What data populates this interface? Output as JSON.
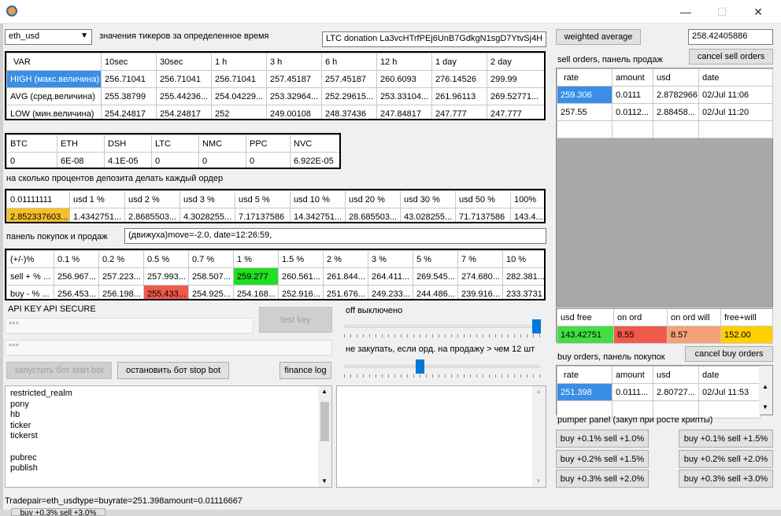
{
  "window": {
    "minimize": "—",
    "maximize": "☐",
    "close": "✕"
  },
  "pair_select": "eth_usd",
  "ticker_caption": "значения тикеров за определенное время",
  "ltc_donation": "LTC donation  La3vcHTrfPEj6UnB7GdkgN1sgD7YtvSj4H",
  "weighted_average_btn": "weighted average",
  "weighted_value": "258.42405886",
  "sell_orders_caption": "sell orders, панель продаж",
  "cancel_sell_btn": "cancel sell orders",
  "ticker_table": {
    "headers": [
      "VAR",
      "10sec",
      "30sec",
      "1 h",
      "3 h",
      "6 h",
      "12 h",
      "1 day",
      "2 day"
    ],
    "rows": [
      [
        "HIGH (макс.величина)",
        "256.71041",
        "256.71041",
        "256.71041",
        "257.45187",
        "257.45187",
        "260.6093",
        "276.14526",
        "299.99"
      ],
      [
        "AVG (сред.величина)",
        "255.38799",
        "255.44236...",
        "254.04229...",
        "253.32964...",
        "252.29615...",
        "253.33104...",
        "261.96113",
        "269.52771..."
      ],
      [
        "LOW (мин.величина)",
        "254.24817",
        "254.24817",
        "252",
        "249.00108",
        "248.37436",
        "247.84817",
        "247.777",
        "247.777"
      ]
    ]
  },
  "balance_table": {
    "headers": [
      "BTC",
      "ETH",
      "DSH",
      "LTC",
      "NMC",
      "PPC",
      "NVC"
    ],
    "values": [
      "0",
      "6E-08",
      "4.1E-05",
      "0",
      "0",
      "0",
      "6.922E-05"
    ]
  },
  "deposit_caption": "на сколько процентов депозита делать каждый ордер",
  "deposit_table": {
    "headers": [
      "0.01111111",
      "usd 1 %",
      "usd 2 %",
      "usd 3 %",
      "usd 5 %",
      "usd 10 %",
      "usd 20 %",
      "usd 30 %",
      "usd 50 %",
      "100%"
    ],
    "values": [
      "2.852337603...",
      "1.4342751...",
      "2.8685503...",
      "4.3028255...",
      "7.17137586",
      "14.342751...",
      "28.685503...",
      "43.028255...",
      "71.7137586",
      "143.4..."
    ]
  },
  "trade_panel_caption": "панель покупок и продаж",
  "move_text": "(движуха)move=-2.0, date=12:26:59,",
  "percent_table": {
    "headers": [
      "(+/-)%",
      "0.1 %",
      "0.2 %",
      "0.5 %",
      "0.7 %",
      "1 %",
      "1.5 %",
      "2 %",
      "3 %",
      "5 %",
      "7 %",
      "10 %"
    ],
    "sell": [
      "sell + % ...",
      "256.967...",
      "257.223...",
      "257.993...",
      "258.507...",
      "259.277",
      "260.561...",
      "261.844...",
      "264.411...",
      "269.545...",
      "274.680...",
      "282.381..."
    ],
    "buy": [
      "buy - % ...",
      "256.453...",
      "256.198...",
      "255.433...",
      "254.925...",
      "254.168...",
      "252.916...",
      "251.676...",
      "249.233...",
      "244.486...",
      "239.916...",
      "233.3731"
    ]
  },
  "api_caption": "API KEY  API SECURE",
  "api_key_value": "***",
  "api_secret_value": "***",
  "test_key_btn": "test key",
  "start_bot_btn": "запустить бот start bot",
  "stop_bot_btn": "остановить бот stop bot",
  "finance_log_btn": "finance log",
  "off_caption": "off выключено",
  "no_buy_caption": "не закупать, если орд. на продажу > чем 12 шт",
  "log_lines": [
    "restricted_realm",
    "pony",
    "hb",
    "ticker",
    "tickerst",
    "",
    "pubrec",
    "publish"
  ],
  "sell_orders": {
    "headers": [
      "rate",
      "amount",
      "usd",
      "date"
    ],
    "rows": [
      [
        "259.306",
        "0.0111",
        "2.8782966",
        "02/Jul 11:06"
      ],
      [
        "257.55",
        "0.0112...",
        "2.88458...",
        "02/Jul 11:20"
      ]
    ]
  },
  "funds": {
    "headers": [
      "usd free",
      "on ord",
      "on ord will",
      "free+will"
    ],
    "values": [
      "143.42751",
      "8.55",
      "8.57",
      "152.00"
    ]
  },
  "buy_orders_caption": "buy orders, панель покупок",
  "cancel_buy_btn": "cancel buy orders",
  "buy_orders": {
    "headers": [
      "rate",
      "amount",
      "usd",
      "date"
    ],
    "rows": [
      [
        "251.398",
        "0.0111...",
        "2.80727...",
        "02/Jul 11:53"
      ]
    ]
  },
  "pumper_caption": "pumper panel (закуп при росте крипты)",
  "pumper_left": [
    "buy +0.1% sell +1.0%",
    "buy +0.2% sell +1.5%",
    "buy +0.3% sell +2.0%"
  ],
  "pumper_right": [
    "buy +0.1% sell +1.5%",
    "buy +0.2% sell +2.0%",
    "buy +0.3% sell +3.0%"
  ],
  "status_text": "Tradepair=eth_usdtype=buyrate=251.398amount=0.01116667",
  "behind_window_text": "buy +0.3% sell +3.0%",
  "colors": {
    "selected": "#3a8ee6",
    "yellow": "#f5c02c",
    "green": "#22dd22",
    "red": "#f05a4a",
    "orange": "#f4a07a",
    "gold": "#ffd000",
    "slider": "#0078d7"
  }
}
